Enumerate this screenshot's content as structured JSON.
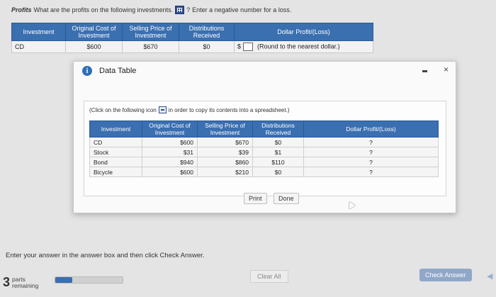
{
  "question": {
    "topic": "Profits",
    "prompt": "What are the profits on the following investments.",
    "hint": "?",
    "note": "Enter a negative number for a loss."
  },
  "main_table": {
    "headers": [
      "Investment",
      "Original Cost of Investment",
      "Selling Price of Investment",
      "Distributions Received",
      "Dollar Profit/(Loss) (Round to the nearest dollar.)"
    ],
    "row": {
      "investment": "CD",
      "original_cost": "$600",
      "selling_price": "$670",
      "distributions": "$0",
      "currency": "$",
      "answer_value": "",
      "round_note": "(Round to the nearest dollar.)"
    }
  },
  "dialog": {
    "title": "Data Table",
    "close": "×",
    "copy_note_before": "(Click on the following icon",
    "copy_note_after": "in order to copy its contents into a spreadsheet.)",
    "headers": [
      "Investment",
      "Original Cost of Investment",
      "Selling Price of Investment",
      "Distributions Received",
      "Dollar Profit/(Loss)"
    ],
    "rows": [
      {
        "investment": "CD",
        "cost": "$600",
        "price": "$670",
        "dist": "$0",
        "profit": "?"
      },
      {
        "investment": "Stock",
        "cost": "$31",
        "price": "$39",
        "dist": "$1",
        "profit": "?"
      },
      {
        "investment": "Bond",
        "cost": "$940",
        "price": "$860",
        "dist": "$110",
        "profit": "?"
      },
      {
        "investment": "Bicycle",
        "cost": "$600",
        "price": "$210",
        "dist": "$0",
        "profit": "?"
      }
    ],
    "print_label": "Print",
    "done_label": "Done"
  },
  "footer": {
    "instruction": "Enter your answer in the answer box and then click Check Answer.",
    "parts_count": "3",
    "parts_line1": "parts",
    "parts_line2": "remaining",
    "progress_fraction": 0.25,
    "clear_label": "Clear All",
    "check_label": "Check Answer",
    "arrow": "◀"
  },
  "colors": {
    "header_blue": "#3a6fb0",
    "check_button": "#8fa7c8"
  }
}
